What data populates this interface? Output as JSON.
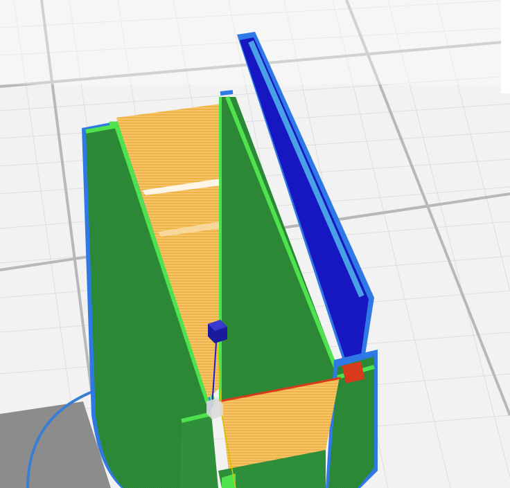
{
  "app": {
    "view": "slicer-layer-preview",
    "background_color": "#f2f2f2",
    "grid_minor_color": "#dcdcdc",
    "grid_major_color": "#b4b4b4"
  },
  "colors": {
    "outer_wall": "#2d8f3a",
    "outer_wall_dark": "#216d2a",
    "inner_wall": "#4ee24e",
    "skin_top": "#1717cc",
    "skin_edge": "#2f79e6",
    "infill": "#f4b23a",
    "infill_light": "#f8d79a",
    "seam": "#d83a1c",
    "travel_marker": "#1a1a9e",
    "plate_shadow": "#8f8f8f",
    "plate_ring": "#3a7ed4"
  },
  "icons": {
    "nozzle_marker": "cube-icon",
    "start_marker": "cube-icon"
  }
}
